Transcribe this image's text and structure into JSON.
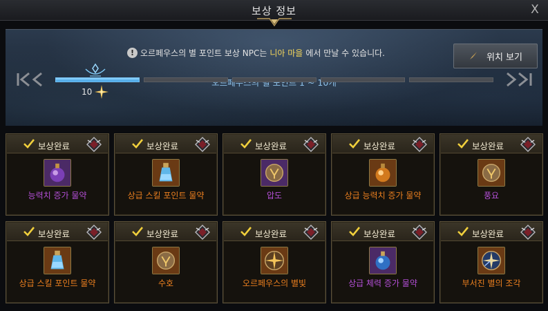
{
  "window": {
    "title": "보상 정보",
    "close_label": "X"
  },
  "header": {
    "notice_prefix": "오르페우스의 별 포인트 보상 NPC는 ",
    "notice_highlight": "니아 마을",
    "notice_suffix": "에서 만날 수 있습니다.",
    "location_button": "위치 보기",
    "point_range": "오르페우스의 별 포인트 1 ~ 10개"
  },
  "progress": {
    "segments": 5,
    "active_segments": 1,
    "count": "10"
  },
  "colors": {
    "purple_text": "#b34fd6",
    "orange_text": "#ea7f1f",
    "notice_highlight": "#f3d55b",
    "point_range_text": "#8fc2ea",
    "check": "#f0cf3c"
  },
  "rewards": [
    {
      "status": "보상완료",
      "name": "능력치 증가 물약",
      "color": "#b34fd6",
      "icon": "purple-potion-icon",
      "icon_bg": "#4b2a66"
    },
    {
      "status": "보상완료",
      "name": "상급 스킬 포인트 물약",
      "color": "#ea7f1f",
      "icon": "blue-flask-icon",
      "icon_bg": "#6a3a14"
    },
    {
      "status": "보상완료",
      "name": "압도",
      "color": "#b34fd6",
      "icon": "rune-icon",
      "icon_bg": "#4b2a66"
    },
    {
      "status": "보상완료",
      "name": "상급 능력치 증가 물약",
      "color": "#ea7f1f",
      "icon": "orange-potion-icon",
      "icon_bg": "#6a3a14"
    },
    {
      "status": "보상완료",
      "name": "풍요",
      "color": "#b34fd6",
      "icon": "rune-icon",
      "icon_bg": "#6a3a14"
    },
    {
      "status": "보상완료",
      "name": "상급 스킬 포인트 물약",
      "color": "#ea7f1f",
      "icon": "blue-flask-icon",
      "icon_bg": "#6a3a14"
    },
    {
      "status": "보상완료",
      "name": "수호",
      "color": "#ea7f1f",
      "icon": "rune-icon",
      "icon_bg": "#6a3a14"
    },
    {
      "status": "보상완료",
      "name": "오르페우스의 별빛",
      "color": "#ea7f1f",
      "icon": "star-emblem-icon",
      "icon_bg": "#6a3a14"
    },
    {
      "status": "보상완료",
      "name": "상급 체력 증가 물약",
      "color": "#b34fd6",
      "icon": "blue-potion-icon",
      "icon_bg": "#4b2a66"
    },
    {
      "status": "보상완료",
      "name": "부서진 별의 조각",
      "color": "#ea7f1f",
      "icon": "broken-star-icon",
      "icon_bg": "#6a3a14"
    }
  ]
}
